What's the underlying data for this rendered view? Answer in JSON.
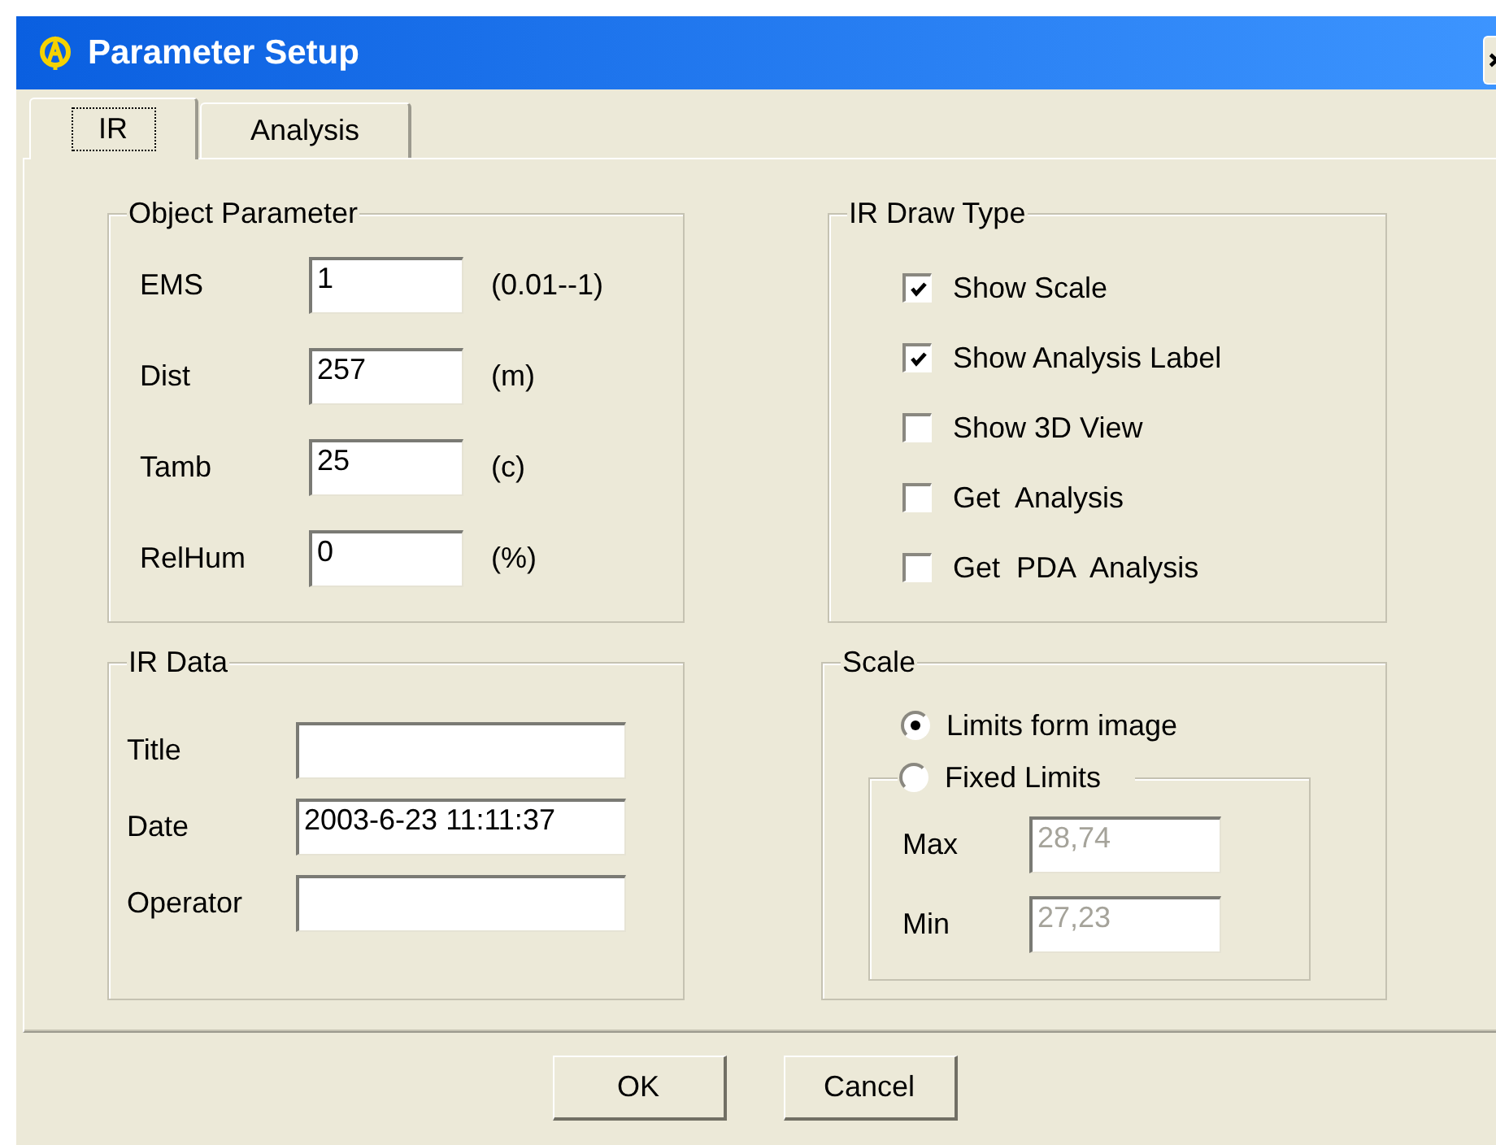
{
  "window": {
    "title": "Parameter Setup"
  },
  "tabs": [
    {
      "label": "IR",
      "selected": true
    },
    {
      "label": "Analysis",
      "selected": false
    }
  ],
  "object_parameter": {
    "title": "Object Parameter",
    "fields": [
      {
        "label": "EMS",
        "value": "1",
        "unit": "(0.01--1)"
      },
      {
        "label": "Dist",
        "value": "257",
        "unit": "(m)"
      },
      {
        "label": "Tamb",
        "value": "25",
        "unit": "(c)"
      },
      {
        "label": "RelHum",
        "value": "0",
        "unit": "(%)"
      }
    ]
  },
  "ir_data": {
    "title": "IR Data",
    "fields": [
      {
        "label": "Title"
      },
      {
        "label": "Date",
        "value": "2003-6-23 11:11:37"
      },
      {
        "label": "Operator"
      }
    ]
  },
  "ir_draw_type": {
    "title": "IR Draw Type",
    "options": [
      {
        "label": "Show Scale",
        "checked": true
      },
      {
        "label": "Show Analysis Label",
        "checked": true
      },
      {
        "label": "Show 3D View",
        "checked": false
      },
      {
        "label": "Get  Analysis",
        "checked": false
      },
      {
        "label": "Get  PDA  Analysis",
        "checked": false
      }
    ]
  },
  "scale": {
    "title": "Scale",
    "options": [
      {
        "label": "Limits form image",
        "selected": true
      },
      {
        "label": "Fixed Limits",
        "selected": false
      }
    ],
    "limits": [
      {
        "label": "Max",
        "value": "28,74",
        "disabled": true
      },
      {
        "label": "Min",
        "value": "27,23",
        "disabled": true
      }
    ]
  },
  "buttons": [
    "OK",
    "Cancel"
  ]
}
